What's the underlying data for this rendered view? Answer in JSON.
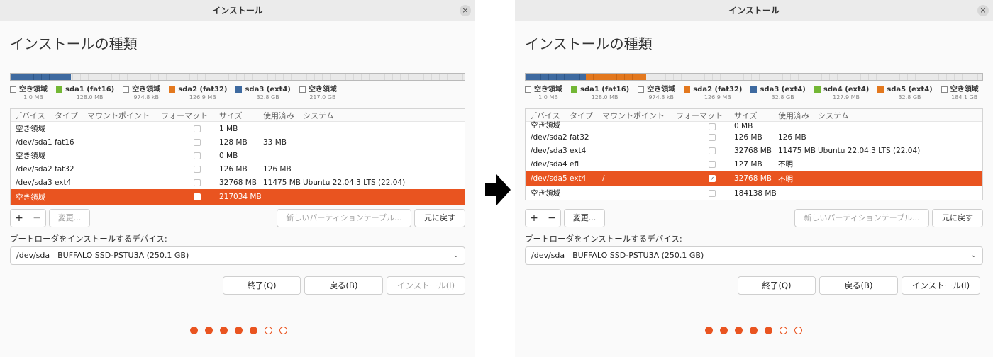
{
  "left": {
    "title": "インストール",
    "close": "×",
    "heading": "インストールの種類",
    "legend": [
      {
        "name": "空き領域",
        "size": "1.0 MB",
        "color": "empty"
      },
      {
        "name": "sda1 (fat16)",
        "size": "128.0 MB",
        "color": "green"
      },
      {
        "name": "空き領域",
        "size": "974.8 kB",
        "color": "empty"
      },
      {
        "name": "sda2 (fat32)",
        "size": "126.9 MB",
        "color": "orange"
      },
      {
        "name": "sda3 (ext4)",
        "size": "32.8 GB",
        "color": "blue"
      },
      {
        "name": "空き領域",
        "size": "217.0 GB",
        "color": "empty"
      }
    ],
    "columns": {
      "device": "デバイス",
      "type": "タイプ",
      "mount": "マウントポイント",
      "format": "フォーマット",
      "size": "サイズ",
      "used": "使用済み",
      "system": "システム"
    },
    "rows": [
      {
        "device": "空き領域",
        "type": "",
        "mount": "",
        "format": false,
        "size": "1 MB",
        "used": "",
        "system": ""
      },
      {
        "device": "/dev/sda1",
        "type": "fat16",
        "mount": "",
        "format": false,
        "size": "128 MB",
        "used": "33 MB",
        "system": ""
      },
      {
        "device": "空き領域",
        "type": "",
        "mount": "",
        "format": false,
        "size": "0 MB",
        "used": "",
        "system": ""
      },
      {
        "device": "/dev/sda2",
        "type": "fat32",
        "mount": "",
        "format": false,
        "size": "126 MB",
        "used": "126 MB",
        "system": ""
      },
      {
        "device": "/dev/sda3",
        "type": "ext4",
        "mount": "",
        "format": false,
        "size": "32768 MB",
        "used": "11475 MB",
        "system": "Ubuntu 22.04.3 LTS (22.04)"
      },
      {
        "device": "空き領域",
        "type": "",
        "mount": "",
        "format": false,
        "size": "217034 MB",
        "used": "",
        "system": "",
        "selected": true
      }
    ],
    "tools": {
      "add": "+",
      "remove": "−",
      "change": "変更...",
      "new_table": "新しいパーティションテーブル...",
      "revert": "元に戻す"
    },
    "boot_label": "ブートローダをインストールするデバイス:",
    "boot_device": "/dev/sda　BUFFALO SSD-PSTU3A (250.1 GB)",
    "buttons": {
      "quit": "終了(Q)",
      "back": "戻る(B)",
      "install": "インストール(I)"
    },
    "progress": {
      "done": 5,
      "total": 7
    }
  },
  "right": {
    "title": "インストール",
    "close": "×",
    "heading": "インストールの種類",
    "legend": [
      {
        "name": "空き領域",
        "size": "1.0 MB",
        "color": "empty"
      },
      {
        "name": "sda1 (fat16)",
        "size": "128.0 MB",
        "color": "green"
      },
      {
        "name": "空き領域",
        "size": "974.8 kB",
        "color": "empty"
      },
      {
        "name": "sda2 (fat32)",
        "size": "126.9 MB",
        "color": "orange"
      },
      {
        "name": "sda3 (ext4)",
        "size": "32.8 GB",
        "color": "blue"
      },
      {
        "name": "sda4 (ext4)",
        "size": "127.9 MB",
        "color": "green"
      },
      {
        "name": "sda5 (ext4)",
        "size": "32.8 GB",
        "color": "orange"
      },
      {
        "name": "空き領域",
        "size": "184.1 GB",
        "color": "empty"
      }
    ],
    "columns": {
      "device": "デバイス",
      "type": "タイプ",
      "mount": "マウントポイント",
      "format": "フォーマット",
      "size": "サイズ",
      "used": "使用済み",
      "system": "システム"
    },
    "rows": [
      {
        "device": "空き領域",
        "type": "",
        "mount": "",
        "format": false,
        "size": "0 MB",
        "used": "",
        "system": ""
      },
      {
        "device": "/dev/sda2",
        "type": "fat32",
        "mount": "",
        "format": false,
        "size": "126 MB",
        "used": "126 MB",
        "system": ""
      },
      {
        "device": "/dev/sda3",
        "type": "ext4",
        "mount": "",
        "format": false,
        "size": "32768 MB",
        "used": "11475 MB",
        "system": "Ubuntu 22.04.3 LTS (22.04)"
      },
      {
        "device": "/dev/sda4",
        "type": "efi",
        "mount": "",
        "format": false,
        "size": "127 MB",
        "used": "不明",
        "system": ""
      },
      {
        "device": "/dev/sda5",
        "type": "ext4",
        "mount": "/",
        "format": true,
        "size": "32768 MB",
        "used": "不明",
        "system": "",
        "selected": true
      },
      {
        "device": "空き領域",
        "type": "",
        "mount": "",
        "format": false,
        "size": "184138 MB",
        "used": "",
        "system": ""
      }
    ],
    "tools": {
      "add": "+",
      "remove": "−",
      "change": "変更...",
      "new_table": "新しいパーティションテーブル...",
      "revert": "元に戻す"
    },
    "boot_label": "ブートローダをインストールするデバイス:",
    "boot_device": "/dev/sda　BUFFALO SSD-PSTU3A (250.1 GB)",
    "buttons": {
      "quit": "終了(Q)",
      "back": "戻る(B)",
      "install": "インストール(I)"
    },
    "progress": {
      "done": 5,
      "total": 7
    }
  }
}
